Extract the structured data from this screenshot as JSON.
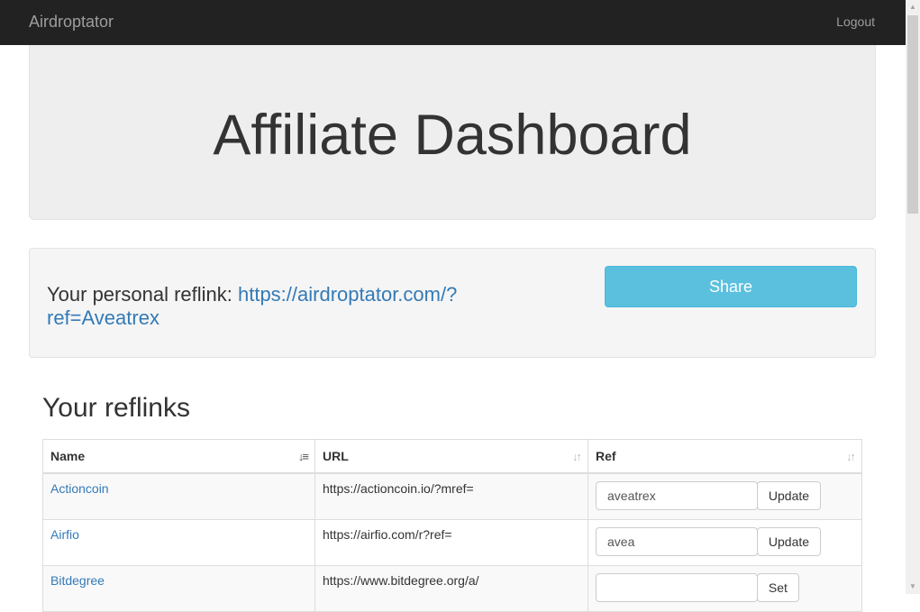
{
  "navbar": {
    "brand": "Airdroptator",
    "logout": "Logout"
  },
  "jumbotron": {
    "title": "Affiliate Dashboard"
  },
  "reflink": {
    "label": "Your personal reflink: ",
    "url": "https://airdroptator.com/?ref=Aveatrex",
    "share_label": "Share"
  },
  "reflinks_section": {
    "title": "Your reflinks"
  },
  "table": {
    "headers": {
      "name": "Name",
      "url": "URL",
      "ref": "Ref"
    },
    "rows": [
      {
        "name": "Actioncoin",
        "url": "https://actioncoin.io/?mref=",
        "ref": "aveatrex",
        "button": "Update"
      },
      {
        "name": "Airfio",
        "url": "https://airfio.com/r?ref=",
        "ref": "avea",
        "button": "Update"
      },
      {
        "name": "Bitdegree",
        "url": "https://www.bitdegree.org/a/",
        "ref": "",
        "button": "Set"
      }
    ]
  },
  "icons": {
    "sort_active": "sort-alpha-icon",
    "sort": "sort-icon"
  }
}
